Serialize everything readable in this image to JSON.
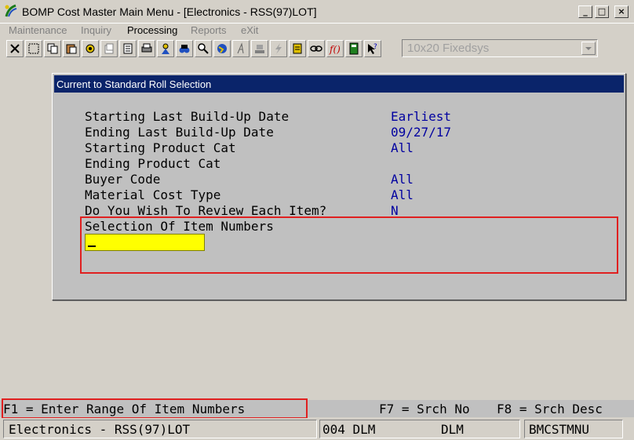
{
  "window": {
    "title": "BOMP Cost Master Main Menu - [Electronics - RSS(97)LOT]",
    "minimize": "_",
    "maximize": "□",
    "close": "×"
  },
  "menu": [
    "Maintenance",
    "Inquiry",
    "Processing",
    "Reports",
    "eXit"
  ],
  "toolbar": {
    "icons": [
      "close-x-icon",
      "select-icon",
      "copy-icon",
      "paste-icon",
      "settings-icon",
      "document-icon",
      "list-icon",
      "printer-icon",
      "user-icon",
      "binoculars-icon",
      "search-icon",
      "globe-icon",
      "font-icon",
      "stamp-icon",
      "lightning-icon",
      "note-icon",
      "link-icon",
      "function-icon",
      "calculator-icon",
      "help-pointer-icon"
    ],
    "font_select": "10x20 Fixedsys"
  },
  "dialog": {
    "title": "Current to Standard Roll Selection",
    "fields": [
      {
        "label": "Starting Last Build-Up Date",
        "value": "Earliest"
      },
      {
        "label": "Ending Last Build-Up Date",
        "value": "09/27/17"
      },
      {
        "label": "Starting Product Cat",
        "value": "All"
      },
      {
        "label": "Ending Product Cat",
        "value": ""
      },
      {
        "label": "Buyer Code",
        "value": "All"
      },
      {
        "label": "Material Cost Type",
        "value": "All"
      },
      {
        "label": "Do You Wish To Review Each Item?",
        "value": "N"
      }
    ],
    "prompt": "Selection Of Item Numbers",
    "input_value": ""
  },
  "helpline": {
    "f1": "F1 = Enter Range Of Item Numbers",
    "f7": "F7 = Srch No",
    "f8": "F8 = Srch Desc"
  },
  "status": {
    "company": "Electronics - RSS(97)LOT",
    "user": "004 DLM",
    "user2": "DLM",
    "program": "BMCSTMNU"
  },
  "colors": {
    "title_bar": "#0a246a",
    "values": "#0000a0",
    "highlight_box": "#e02020",
    "input_bg": "#ffff00"
  }
}
